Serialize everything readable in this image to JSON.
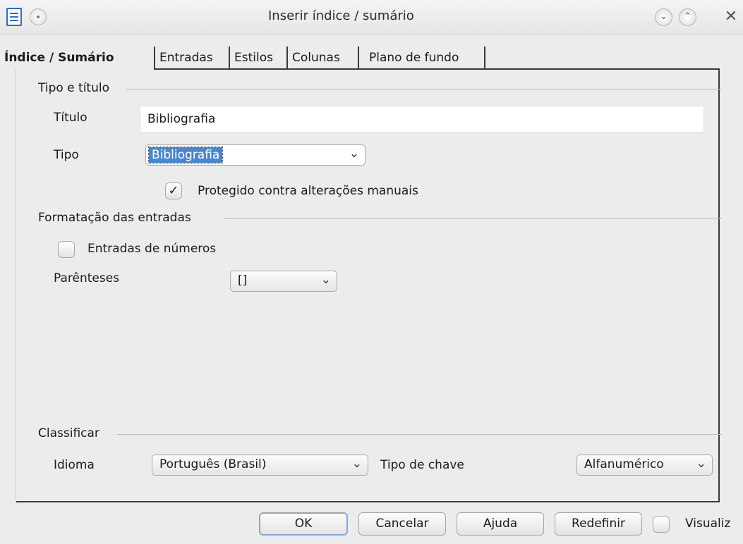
{
  "window": {
    "title": "Inserir índice / sumário",
    "minimize_icon": "chevron-down",
    "maximize_icon": "chevron-up",
    "close_icon": "x"
  },
  "tabs": [
    {
      "label": "Índice / Sumário",
      "active": true
    },
    {
      "label": "Entradas"
    },
    {
      "label": "Estilos"
    },
    {
      "label": "Colunas"
    },
    {
      "label": "Plano de fundo"
    }
  ],
  "type_title": {
    "heading": "Tipo e título",
    "title_label": "Título",
    "title_value": "Bibliografia",
    "type_label": "Tipo",
    "type_value": "Bibliografia",
    "protected_label": "Protegido contra alterações manuais",
    "protected_checked": true
  },
  "entries_format": {
    "heading": "Formatação das entradas",
    "number_entries_label": "Entradas de números",
    "number_entries_checked": false,
    "brackets_label": "Parênteses",
    "brackets_value": "[]"
  },
  "sort": {
    "heading": "Classificar",
    "language_label": "Idioma",
    "language_value": "Português (Brasil)",
    "key_type_label": "Tipo de chave",
    "key_type_value": "Alfanumérico"
  },
  "footer": {
    "ok": "OK",
    "cancel": "Cancelar",
    "help": "Ajuda",
    "reset": "Redefinir",
    "preview_label": "Visualiz",
    "preview_checked": false
  }
}
